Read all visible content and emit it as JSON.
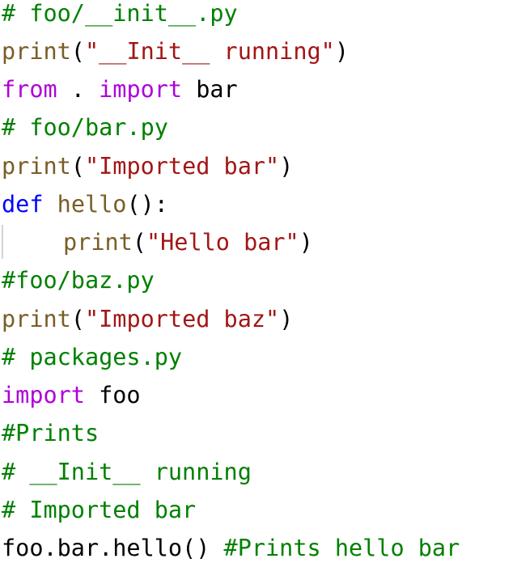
{
  "code": {
    "line1": {
      "comment": "# foo/__init__.py"
    },
    "line2": {
      "func": "print",
      "open": "(",
      "string": "\"__Init__ running\"",
      "close": ")"
    },
    "line3": {
      "kw_from": "from",
      "middle": " . ",
      "kw_import": "import",
      "name": " bar"
    },
    "line4": {
      "comment": "# foo/bar.py"
    },
    "line5": {
      "func": "print",
      "open": "(",
      "string": "\"Imported bar\"",
      "close": ")"
    },
    "line6": {
      "kw_def": "def",
      "space": " ",
      "func": "hello",
      "rest": "():"
    },
    "line7": {
      "func": "print",
      "open": "(",
      "string": "\"Hello bar\"",
      "close": ")"
    },
    "line8": {
      "comment": "#foo/baz.py"
    },
    "line9": {
      "func": "print",
      "open": "(",
      "string": "\"Imported baz\"",
      "close": ")"
    },
    "line10": {
      "comment": "# packages.py"
    },
    "line11": {
      "kw_import": "import",
      "name": " foo"
    },
    "line12": {
      "comment": "#Prints"
    },
    "line13": {
      "comment": "# __Init__ running"
    },
    "line14": {
      "comment": "# Imported bar"
    },
    "line15": {
      "code": "foo.bar.hello() ",
      "comment": "#Prints hello bar"
    }
  },
  "colors": {
    "comment": "#008000",
    "control_keyword": "#af00db",
    "def_keyword": "#0000ff",
    "function": "#795e26",
    "string": "#a31515",
    "plain": "#000000",
    "indent_guide": "#d4d4d4"
  }
}
